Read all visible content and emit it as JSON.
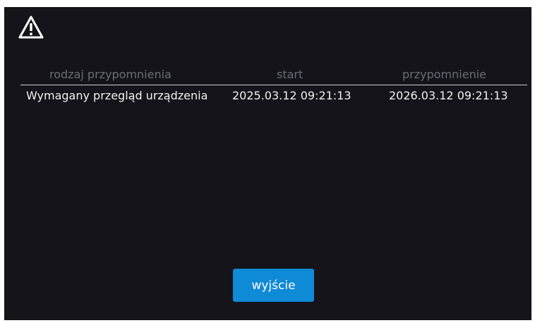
{
  "header": {
    "warning_icon": "warning-triangle-icon"
  },
  "table": {
    "columns": [
      "rodzaj przypomnienia",
      "start",
      "przypomnienie"
    ],
    "rows": [
      {
        "type": "Wymagany przegląd urządzenia",
        "start": "2025.03.12 09:21:13",
        "reminder": "2026.03.12 09:21:13"
      }
    ]
  },
  "footer": {
    "exit_label": "wyjście"
  },
  "colors": {
    "background": "#14141a",
    "header_text": "#6c6c76",
    "row_text": "#f2f2f2",
    "accent_button": "#0f8ad6"
  }
}
